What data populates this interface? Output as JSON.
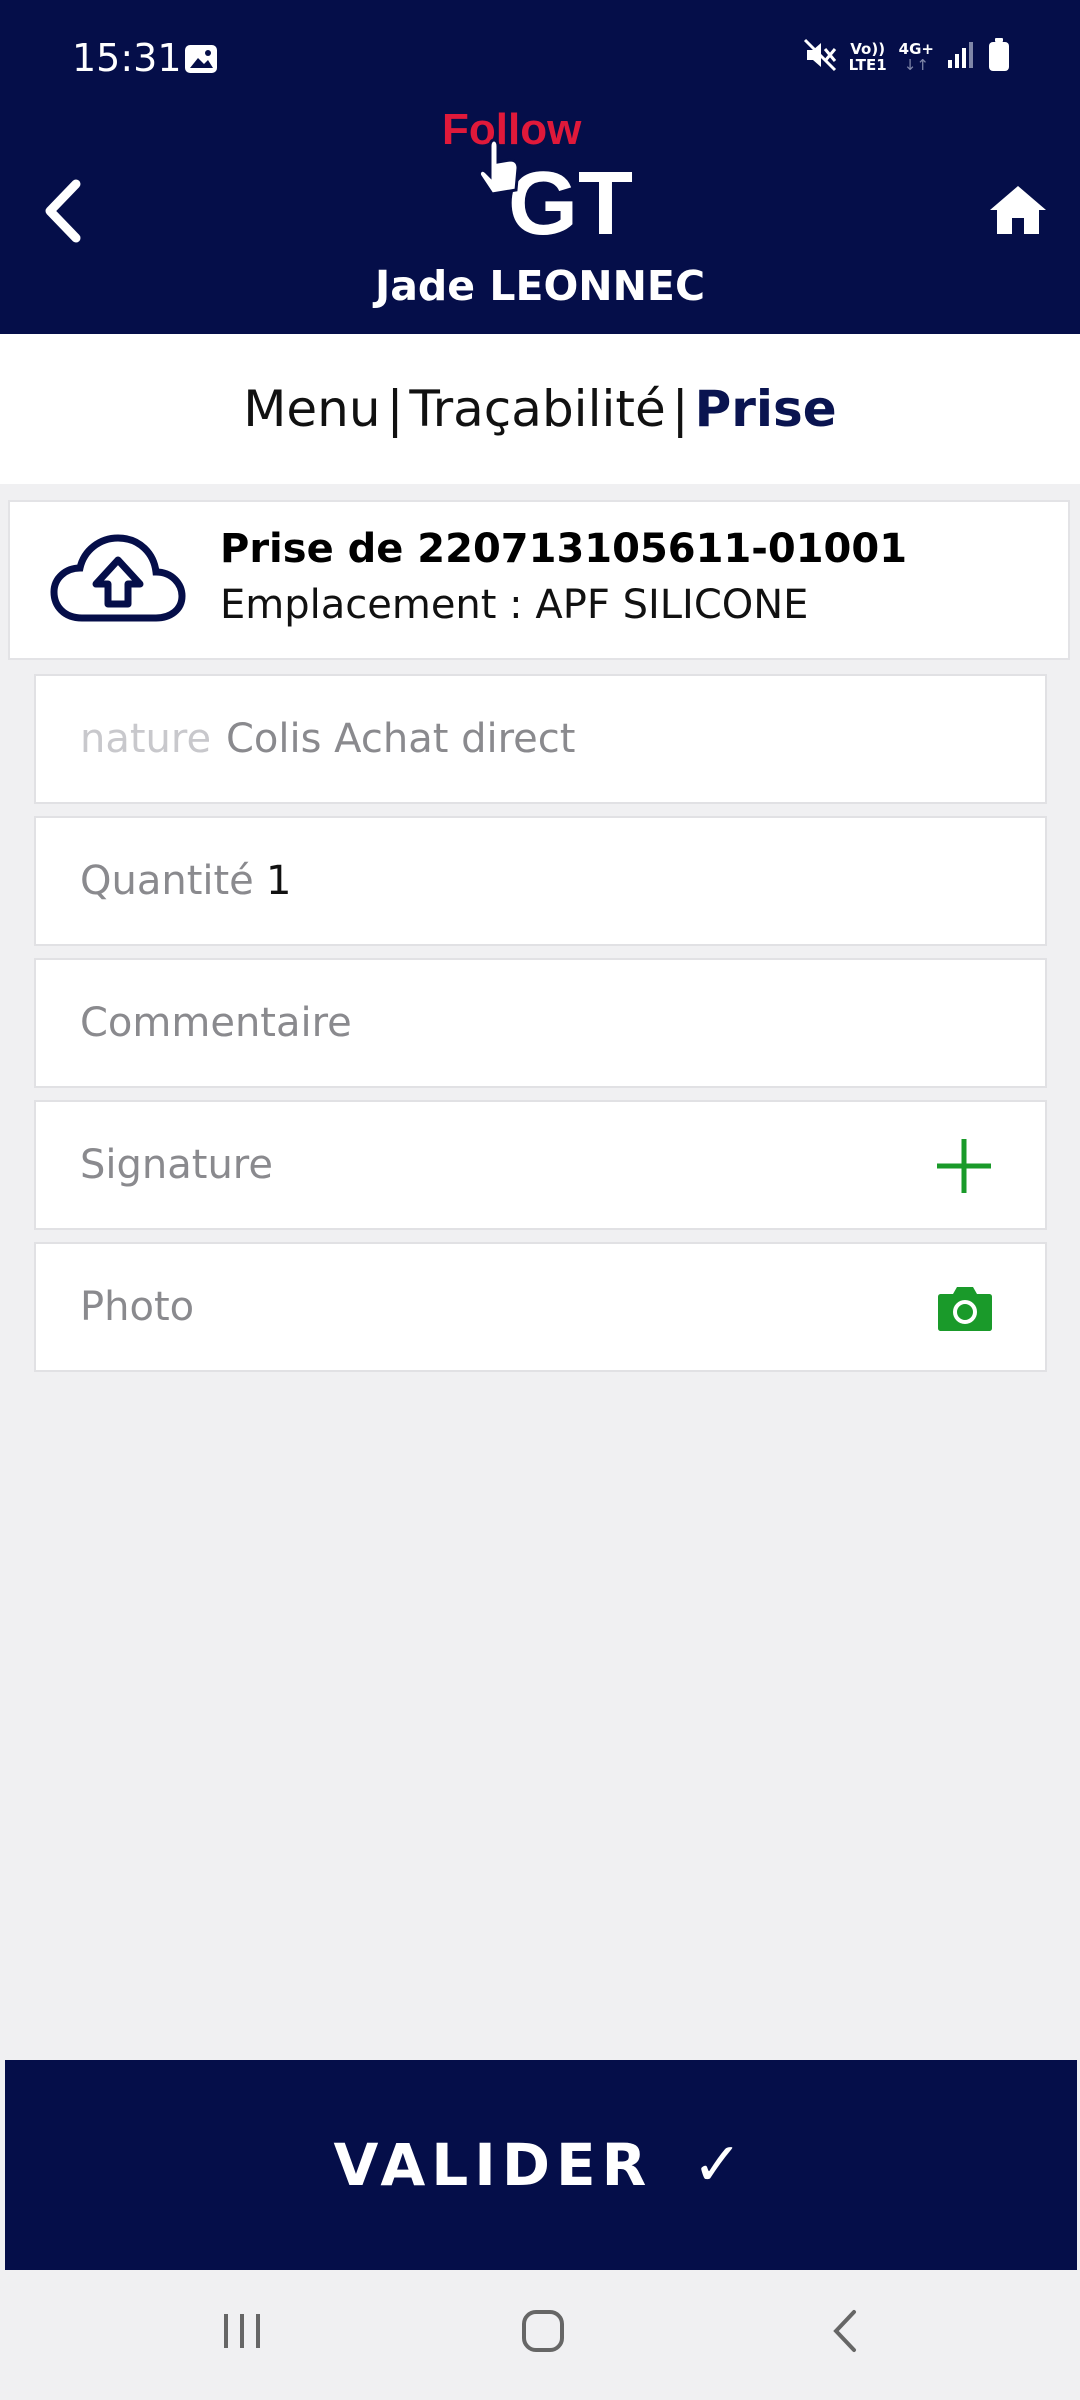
{
  "status_bar": {
    "time": "15:31",
    "volte_top": "Vo))",
    "volte_bottom": "LTE1",
    "network": "4G+"
  },
  "header": {
    "logo_top": "Follow",
    "logo_bottom": "GT",
    "user_name": "Jade LEONNEC"
  },
  "breadcrumb": {
    "items": [
      "Menu",
      "Traçabilité",
      "Prise"
    ],
    "separator": "|"
  },
  "info": {
    "title": "Prise de 220713105611-01001",
    "location": "Emplacement : APF SILICONE"
  },
  "form": {
    "nature_label": "nature",
    "nature_value": "Colis Achat direct",
    "quantity_label": "Quantité",
    "quantity_value": "1",
    "comment_placeholder": "Commentaire",
    "signature_label": "Signature",
    "photo_label": "Photo"
  },
  "actions": {
    "validate_label": "VALIDER",
    "validate_check": "✓"
  },
  "colors": {
    "primary": "#050e49",
    "logo_red": "#e0193a",
    "accent_green": "#1a9a2a"
  },
  "icons": [
    "back-chevron",
    "home",
    "cloud-upload",
    "plus",
    "camera",
    "nav-recents",
    "nav-home",
    "nav-back"
  ]
}
